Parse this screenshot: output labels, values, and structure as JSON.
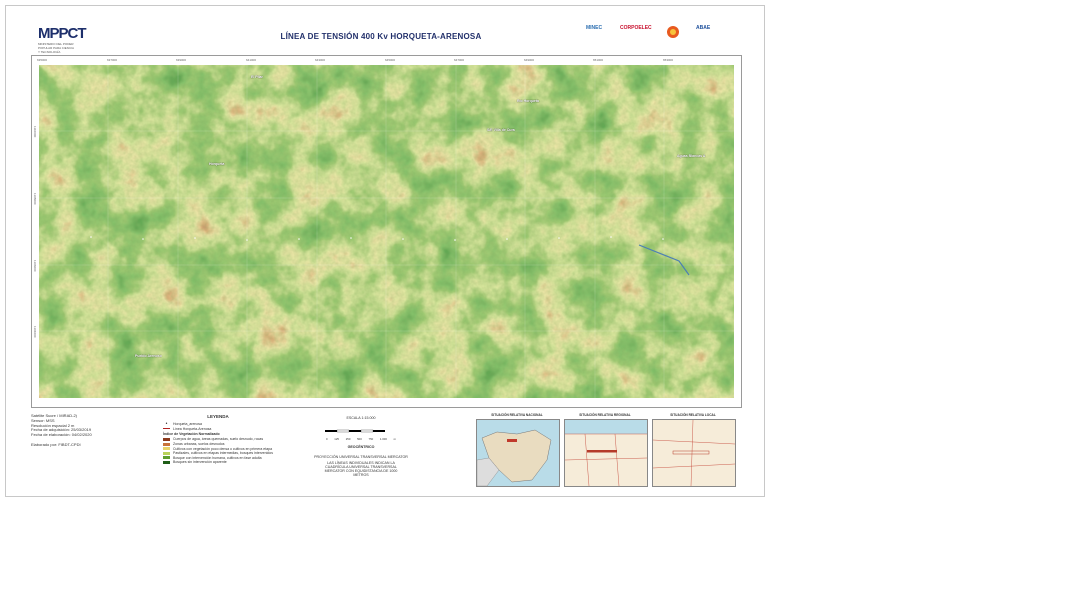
{
  "header": {
    "logo_text": "MPPCT",
    "logo_sub": "MINISTERIO DEL PODER POPULAR PARA CIENCIA Y TECNOLOGÍA",
    "title": "LÍNEA DE TENSIÓN 400 Kv HORQUETA-ARENOSA",
    "partners": [
      "MINEC",
      "CORPOELEC",
      "",
      "ABAE"
    ]
  },
  "map": {
    "place_labels": [
      "El Pilar",
      "Río Horqueta",
      "S/E Villa de Cura",
      "Aguas Blancas A",
      "Horqueta",
      "Pueblo Arenoso"
    ],
    "ticks_top": [
      "635000",
      "637000",
      "639000",
      "641000",
      "643000",
      "645000",
      "647000",
      "649000",
      "651000",
      "653000",
      "655000"
    ],
    "ticks_left": [
      "1110000",
      "1108000",
      "1106000",
      "1104000"
    ]
  },
  "metadata": {
    "lines": [
      "Satélite Sucre / MIRAD-2)",
      "Sensor: MSS",
      "Resolución espacial 2 m",
      "Fecha de adquisición: 25/03/2019",
      "Fecha de elaboración: 04/02/2020",
      "",
      "Elaborado por: FIBDT-CPDI"
    ]
  },
  "legend": {
    "title": "LEYENDA",
    "point_item": "Horqueta_arenosa",
    "line_item": "Línea Horqueta-Arenosa",
    "index_title": "Índice de Vegetación Normalizado",
    "classes": [
      {
        "label": "Cuerpos de agua, áreas quemadas, suelo desnudo, rocas",
        "color": "#8b3a1e"
      },
      {
        "label": "Zonas urbanas, suelos desnudos",
        "color": "#c8733a"
      },
      {
        "label": "Cultivos con vegetación poco densa o cultivos en primera etapa",
        "color": "#e8d36a"
      },
      {
        "label": "Pastizales, cultivos en etapas intermedias, bosques intervenidos",
        "color": "#b9d25a"
      },
      {
        "label": "Bosque con intervención humana, cultivos en fase adulta",
        "color": "#5f9e2e"
      },
      {
        "label": "Bosques sin intervención aparente",
        "color": "#1f5e17"
      }
    ]
  },
  "scale": {
    "text": "ESCALA 1:15.000",
    "bar_labels": [
      "0",
      "125",
      "250",
      "500",
      "750",
      "1.000"
    ],
    "unit": "m",
    "datum": "GEOCÉNTRICO",
    "projection": "PROYECCIÓN UNIVERSAL TRANSVERSAL MERCATOR",
    "note": "LAS LÍNEAS INDIVIDUALES INDICAN LA CUADRÍCULA UNIVERSAL TRANSVERSAL MERCATOR CON EQUIDISTANCIA DE 1000 METROS"
  },
  "insets": [
    {
      "title": "SITUACIÓN RELATIVA NACIONAL"
    },
    {
      "title": "SITUACIÓN RELATIVA REGIONAL"
    },
    {
      "title": "SITUACIÓN RELATIVA LOCAL"
    }
  ],
  "colors": {
    "title": "#22306b",
    "vegetation_dense": "#1f5e17",
    "vegetation_light": "#e8d36a",
    "bare": "#c8733a"
  }
}
